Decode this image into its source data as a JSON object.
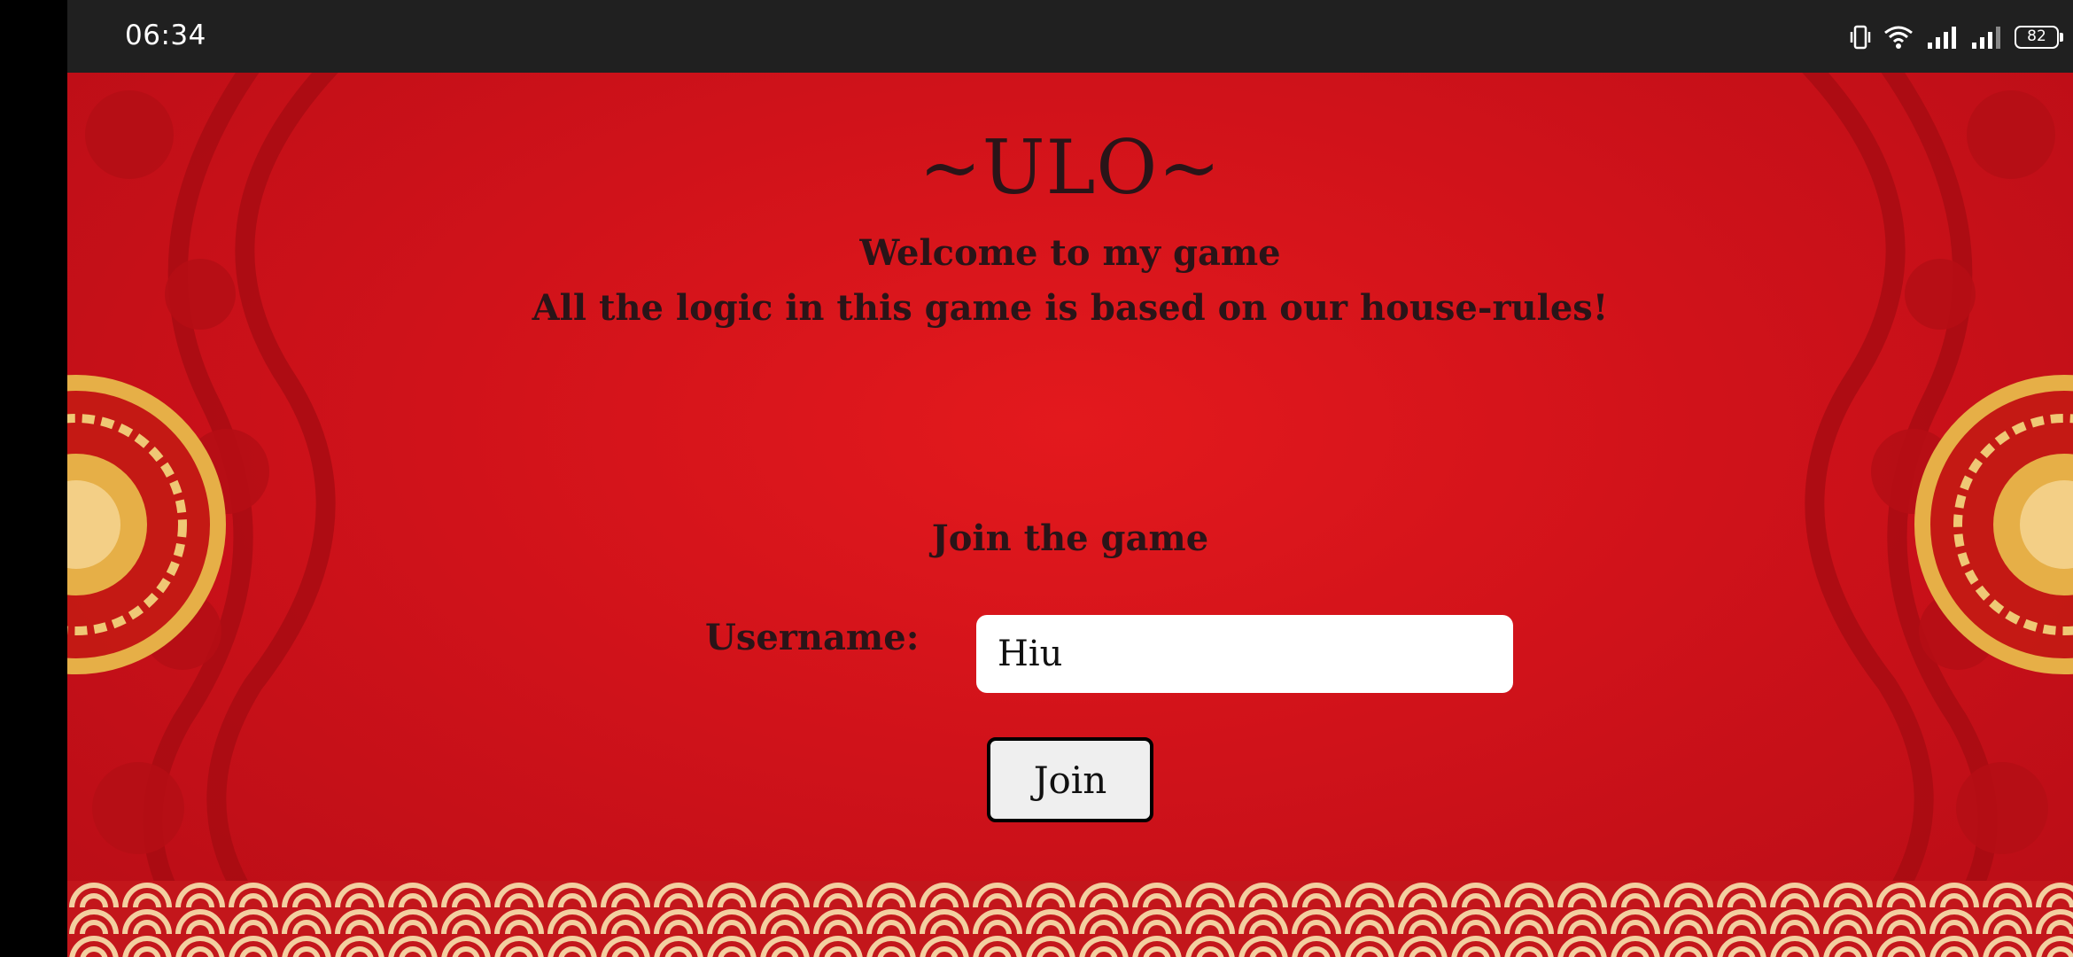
{
  "status_bar": {
    "time": "06:34",
    "battery": "82",
    "icons": [
      "vibrate-icon",
      "wifi-icon",
      "signal-icon",
      "signal-icon-2",
      "battery-icon"
    ]
  },
  "game": {
    "title": "~ULO~",
    "welcome": "Welcome to my game",
    "rules_note": "All the logic in this game is based on our house-rules!",
    "join_heading": "Join the game",
    "username_label": "Username:",
    "username_value": "Hiu",
    "join_button": "Join"
  },
  "colors": {
    "background_red": "#d0121a",
    "text_dark": "#2a1418",
    "ornament_gold": "#e8b84a",
    "status_bar": "#202020"
  }
}
